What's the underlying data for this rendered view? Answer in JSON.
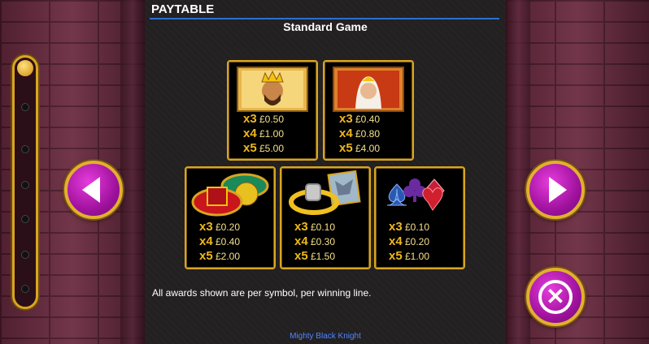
{
  "header": {
    "title": "PAYTABLE",
    "subtitle": "Standard Game"
  },
  "cards": [
    {
      "symbol": "king-icon",
      "pays": [
        {
          "mult": "x3",
          "value": "£0.50"
        },
        {
          "mult": "x4",
          "value": "£1.00"
        },
        {
          "mult": "x5",
          "value": "£5.00"
        }
      ]
    },
    {
      "symbol": "queen-icon",
      "pays": [
        {
          "mult": "x3",
          "value": "£0.40"
        },
        {
          "mult": "x4",
          "value": "£0.80"
        },
        {
          "mult": "x5",
          "value": "£4.00"
        }
      ]
    },
    {
      "symbol": "crown-orb-icon",
      "pays": [
        {
          "mult": "x3",
          "value": "£0.20"
        },
        {
          "mult": "x4",
          "value": "£0.40"
        },
        {
          "mult": "x5",
          "value": "£2.00"
        }
      ]
    },
    {
      "symbol": "ring-map-icon",
      "pays": [
        {
          "mult": "x3",
          "value": "£0.10"
        },
        {
          "mult": "x4",
          "value": "£0.30"
        },
        {
          "mult": "x5",
          "value": "£1.50"
        }
      ]
    },
    {
      "symbol": "card-suits-icon",
      "pays": [
        {
          "mult": "x3",
          "value": "£0.10"
        },
        {
          "mult": "x4",
          "value": "£0.20"
        },
        {
          "mult": "x5",
          "value": "£1.00"
        }
      ]
    }
  ],
  "note": "All awards shown are per symbol, per winning line.",
  "footer": {
    "game_name": "Mighty Black Knight"
  },
  "colors": {
    "gold": "#d9a520",
    "button": "#a0129e",
    "link_blue": "#4f86ff"
  },
  "controls": {
    "prev": "chevron-left-icon",
    "next": "chevron-right-icon",
    "close": "close-icon"
  }
}
